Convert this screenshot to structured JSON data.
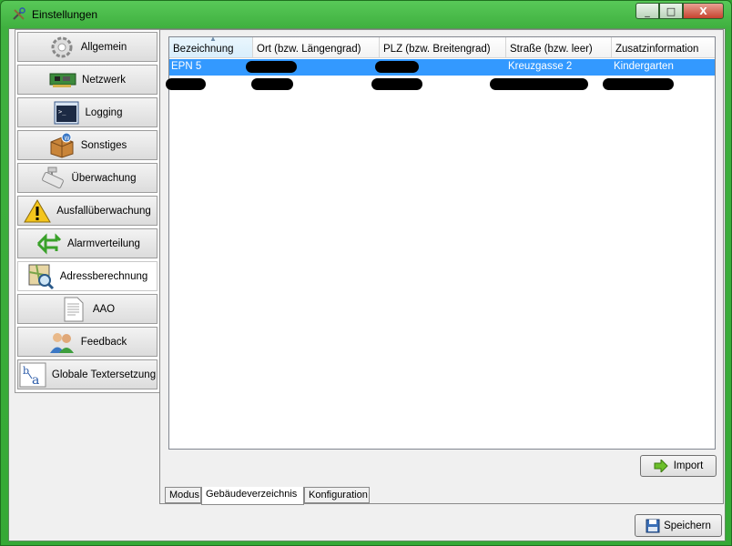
{
  "window": {
    "title": "Einstellungen",
    "close_label": "X",
    "min_label": "_",
    "max_label": "□"
  },
  "sidebar": {
    "items": [
      {
        "label": "Allgemein",
        "icon": "gear-icon"
      },
      {
        "label": "Netzwerk",
        "icon": "network-card-icon"
      },
      {
        "label": "Logging",
        "icon": "terminal-icon"
      },
      {
        "label": "Sonstiges",
        "icon": "package-icon"
      },
      {
        "label": "Überwachung",
        "icon": "camera-icon"
      },
      {
        "label": "Ausfallüberwachung",
        "icon": "warning-icon"
      },
      {
        "label": "Alarmverteilung",
        "icon": "arrows-icon"
      },
      {
        "label": "Adressberechnung",
        "icon": "map-search-icon",
        "active": true
      },
      {
        "label": "AAO",
        "icon": "document-icon"
      },
      {
        "label": "Feedback",
        "icon": "users-icon"
      },
      {
        "label": "Globale Textersetzung",
        "icon": "text-replace-icon"
      }
    ]
  },
  "table": {
    "columns": [
      "Bezeichnung",
      "Ort (bzw. Längengrad)",
      "PLZ (bzw. Breitengrad)",
      "Straße (bzw. leer)",
      "Zusatzinformation"
    ],
    "rows": [
      {
        "cells": [
          "EPN 5",
          "",
          "",
          "Kreuzgasse 2",
          "Kindergarten"
        ],
        "selected": true
      },
      {
        "cells": [
          "",
          "",
          "",
          "",
          ""
        ],
        "selected": false
      }
    ]
  },
  "buttons": {
    "import_label": "Import",
    "save_label": "Speichern"
  },
  "tabs": [
    {
      "label": "Modus",
      "active": false
    },
    {
      "label": "Gebäudeverzeichnis",
      "active": true
    },
    {
      "label": "Konfiguration",
      "active": false
    }
  ],
  "colors": {
    "selection": "#3399ff",
    "frame": "#3fb03f"
  }
}
